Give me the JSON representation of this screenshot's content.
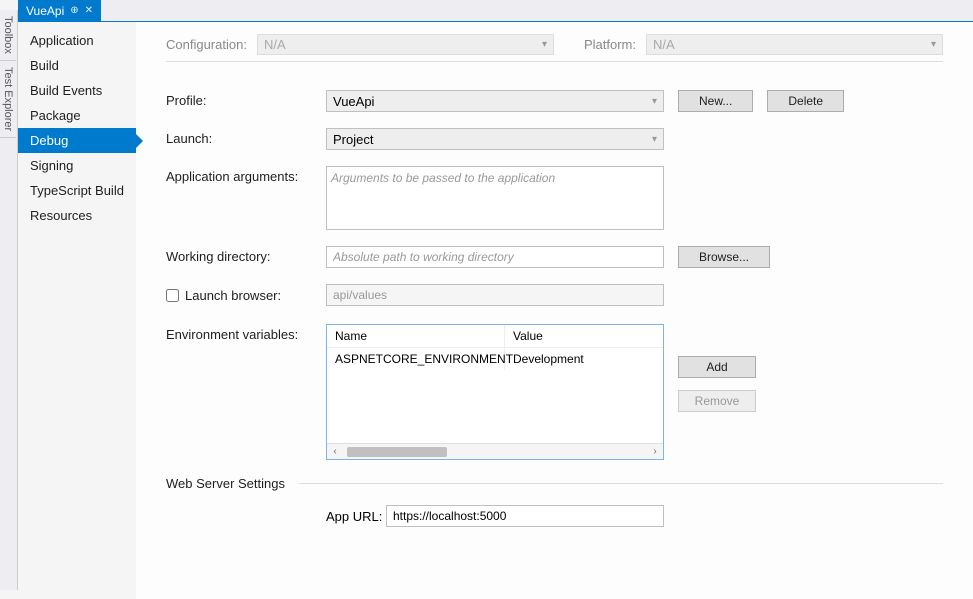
{
  "sideTabs": {
    "toolbox": "Toolbox",
    "testExplorer": "Test Explorer"
  },
  "docTab": {
    "title": "VueApi"
  },
  "nav": {
    "items": [
      "Application",
      "Build",
      "Build Events",
      "Package",
      "Debug",
      "Signing",
      "TypeScript Build",
      "Resources"
    ],
    "selectedIndex": 4
  },
  "configRow": {
    "configurationLabel": "Configuration:",
    "configurationValue": "N/A",
    "platformLabel": "Platform:",
    "platformValue": "N/A"
  },
  "form": {
    "profileLabel": "Profile:",
    "profileValue": "VueApi",
    "newButton": "New...",
    "deleteButton": "Delete",
    "launchLabel": "Launch:",
    "launchValue": "Project",
    "appArgsLabel": "Application arguments:",
    "appArgsPlaceholder": "Arguments to be passed to the application",
    "workDirLabel": "Working directory:",
    "workDirPlaceholder": "Absolute path to working directory",
    "browseButton": "Browse...",
    "launchBrowserLabel": "Launch browser:",
    "launchBrowserValue": "api/values",
    "envVarsLabel": "Environment variables:",
    "envHeaderName": "Name",
    "envHeaderValue": "Value",
    "envRows": [
      {
        "name": "ASPNETCORE_ENVIRONMENT",
        "value": "Development"
      }
    ],
    "addButton": "Add",
    "removeButton": "Remove",
    "webServerSection": "Web Server Settings",
    "appUrlLabel": "App URL:",
    "appUrlValue": "https://localhost:5000"
  }
}
